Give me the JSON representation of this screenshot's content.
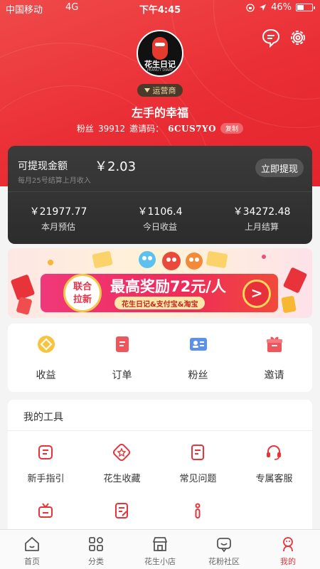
{
  "status_bar": {
    "carrier": "中国移动",
    "network": "4G",
    "time": "下午4:45",
    "battery": "46%",
    "battery_level": 0.46
  },
  "profile": {
    "avatar_brand": "花生日记",
    "avatar_brand_en": "PEANUT DIARY",
    "role_badge": "运营商",
    "username": "左手的幸福",
    "fans_label": "粉丝",
    "fans_count": "39912",
    "invite_label": "邀请码：",
    "invite_code": "6CUS7YO",
    "copy_label": "复制"
  },
  "balance": {
    "label": "可提现金额",
    "amount": "￥2.03",
    "note": "每月25号结算上月收入",
    "withdraw_label": "立即提现",
    "stats": [
      {
        "value": "￥21977.77",
        "label": "本月预估"
      },
      {
        "value": "￥1106.4",
        "label": "今日收益"
      },
      {
        "value": "￥34272.48",
        "label": "上月结算"
      }
    ]
  },
  "banner": {
    "badge_line1": "联合",
    "badge_line2": "拉新",
    "headline": "最高奖励72元/人",
    "subline": "花生日记&支付宝&淘宝",
    "arrow": ">"
  },
  "quick_actions": [
    {
      "label": "收益",
      "icon": "coin-icon"
    },
    {
      "label": "订单",
      "icon": "order-icon"
    },
    {
      "label": "粉丝",
      "icon": "fans-card-icon"
    },
    {
      "label": "邀请",
      "icon": "gift-icon"
    }
  ],
  "tools": {
    "title": "我的工具",
    "items": [
      {
        "label": "新手指引",
        "icon": "guide-icon"
      },
      {
        "label": "花生收藏",
        "icon": "star-icon"
      },
      {
        "label": "常见问题",
        "icon": "faq-icon"
      },
      {
        "label": "专属客服",
        "icon": "headset-icon"
      },
      {
        "label": "",
        "icon": "tv-icon"
      },
      {
        "label": "",
        "icon": "edit-note-icon"
      },
      {
        "label": "",
        "icon": "info-icon"
      }
    ]
  },
  "tab_bar": [
    {
      "label": "首页",
      "icon": "home-icon"
    },
    {
      "label": "分类",
      "icon": "category-icon"
    },
    {
      "label": "花生小店",
      "icon": "shop-icon"
    },
    {
      "label": "花粉社区",
      "icon": "community-icon"
    },
    {
      "label": "我的",
      "icon": "profile-icon",
      "active": true
    }
  ],
  "colors": {
    "brand_red": "#e8333a",
    "card_dark": "#2f2f2f",
    "gold": "#f2d9a6"
  }
}
